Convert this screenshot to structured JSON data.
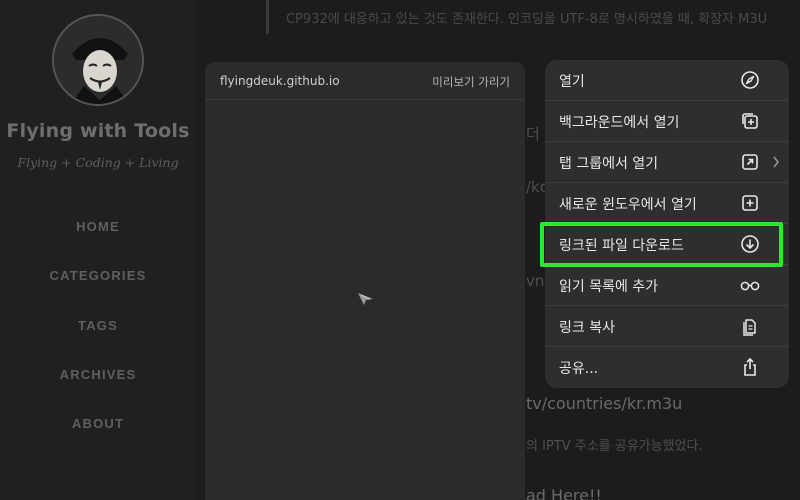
{
  "sidebar": {
    "site_title": "Flying with Tools",
    "subtitle": "Flying + Coding + Living",
    "nav": [
      "HOME",
      "CATEGORIES",
      "TAGS",
      "ARCHIVES",
      "ABOUT"
    ]
  },
  "background": {
    "quote_text": "CP932에 대응하고 있는 것도 존재한다. 인코딩을 UTF-8로 명시하였을 때, 확장자 M3U",
    "fragments": [
      "더 본",
      "/kc",
      "vnlo",
      "tv/countries/kr.m3u",
      "의 IPTV 주소를 공유가능했었다.",
      "ad Here!!"
    ]
  },
  "preview": {
    "url": "flyingdeuk.github.io",
    "hide_label": "미리보기 가리기"
  },
  "menu": {
    "items": [
      {
        "label": "열기",
        "icon": "compass-icon"
      },
      {
        "label": "백그라운드에서 열기",
        "icon": "background-tab-icon"
      },
      {
        "label": "탭 그룹에서 열기",
        "icon": "tab-group-icon",
        "has_submenu": true
      },
      {
        "label": "새로운 윈도우에서 열기",
        "icon": "new-window-icon"
      },
      {
        "label": "링크된 파일 다운로드",
        "icon": "download-icon",
        "highlighted": true
      },
      {
        "label": "읽기 목록에 추가",
        "icon": "glasses-icon"
      },
      {
        "label": "링크 복사",
        "icon": "copy-icon"
      },
      {
        "label": "공유...",
        "icon": "share-icon"
      }
    ]
  },
  "colors": {
    "highlight": "#2ee82e",
    "menu_bg": "#2e2e30",
    "preview_bg": "#2b2b2d"
  }
}
